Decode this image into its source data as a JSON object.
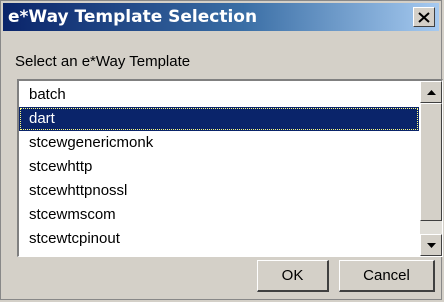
{
  "dialog": {
    "title": "e*Way Template Selection",
    "prompt": "Select an e*Way Template"
  },
  "templates": {
    "items": [
      "batch",
      "dart",
      "stcewgenericmonk",
      "stcewhttp",
      "stcewhttpnossl",
      "stcewmscom",
      "stcewtcpinout"
    ],
    "selected": "dart"
  },
  "buttons": {
    "ok_label": "OK",
    "cancel_label": "Cancel"
  },
  "icons": {
    "close": "close-icon",
    "scroll_up": "scroll-up-arrow-icon",
    "scroll_down": "scroll-down-arrow-icon"
  },
  "colors": {
    "titlebar_start": "#0a246a",
    "titlebar_end": "#a6caf0",
    "selection": "#0a246a",
    "face": "#d4d0c8"
  }
}
